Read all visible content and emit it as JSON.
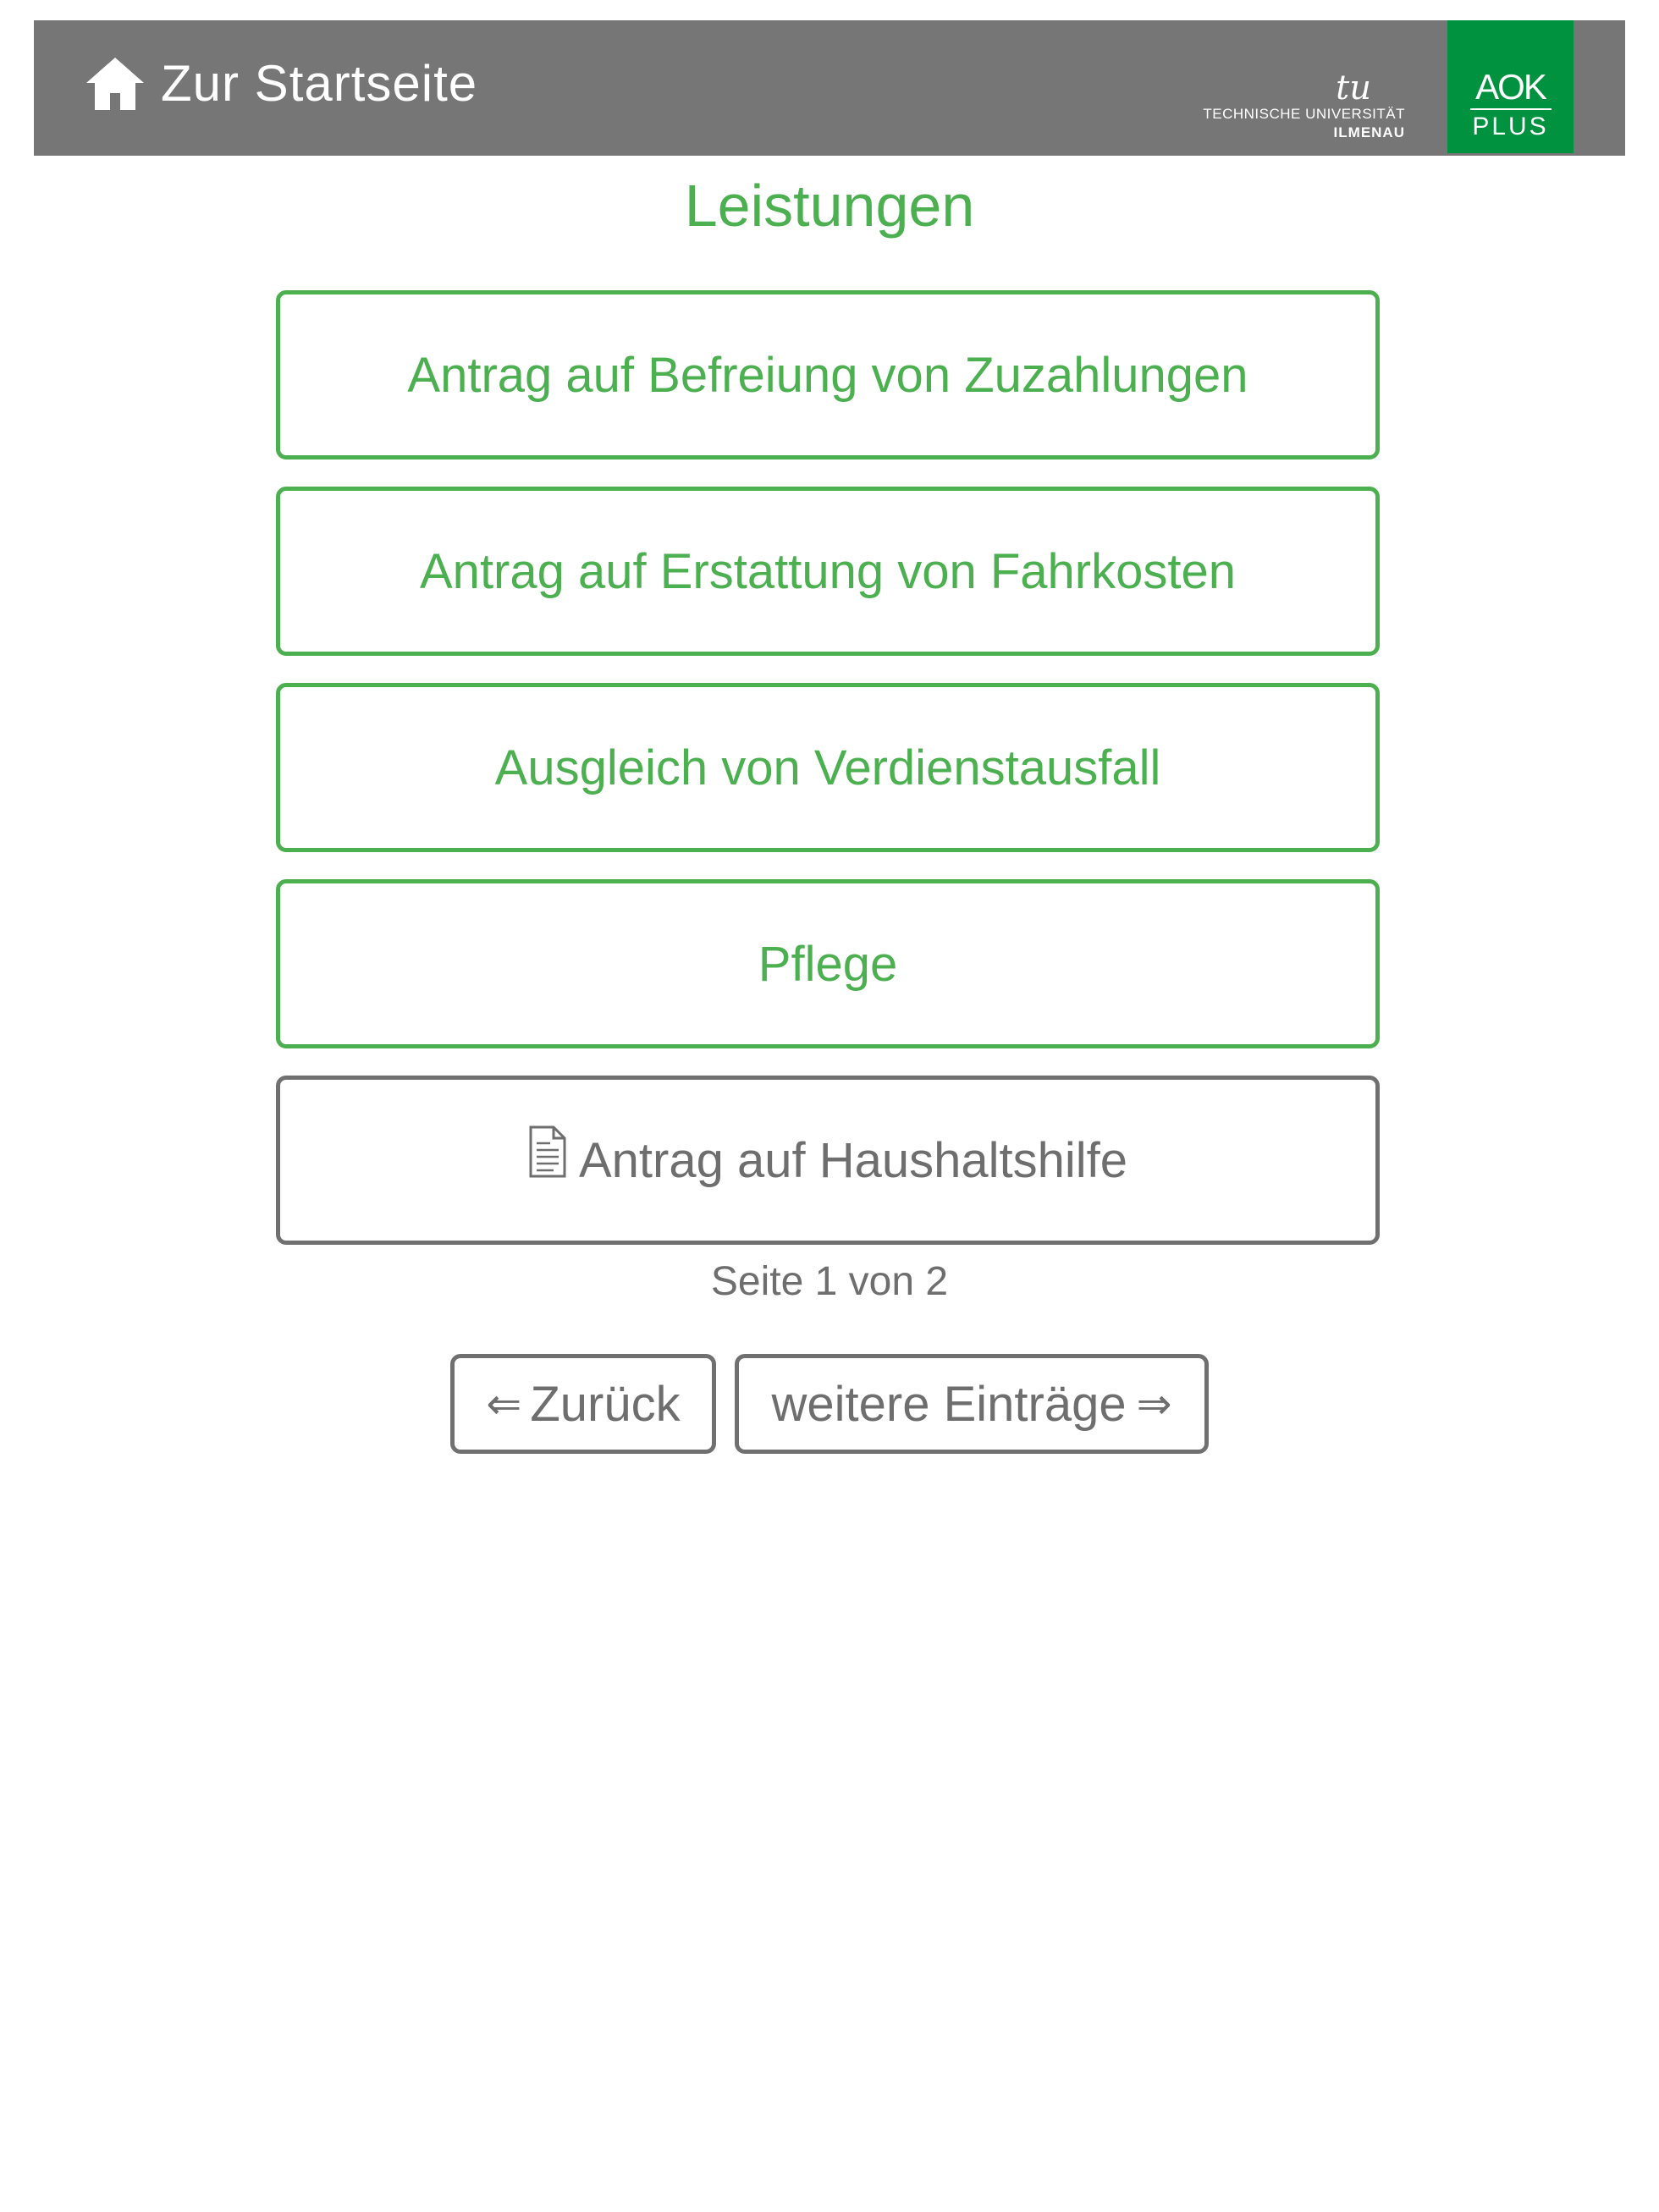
{
  "header": {
    "home_label": "Zur Startseite",
    "home_icon": "home-icon",
    "tu_logo": {
      "mark": "tu",
      "line1": "TECHNISCHE UNIVERSITÄT",
      "line2": "ILMENAU"
    },
    "aok_logo": {
      "top": "AOK",
      "bottom": "PLUS"
    },
    "colors": {
      "header_bg": "#767676",
      "aok_green": "#00923f"
    }
  },
  "page": {
    "title": "Leistungen",
    "accent": "#4caf50",
    "items": [
      {
        "label": "Antrag auf Befreiung von Zuzahlungen"
      },
      {
        "label": "Antrag auf Erstattung von Fahrkosten"
      },
      {
        "label": "Ausgleich von Verdienstausfall"
      },
      {
        "label": "Pflege"
      },
      {
        "label": "Antrag auf Haushaltshilfe",
        "icon": "document-icon"
      }
    ],
    "pagination": {
      "text": "Seite 1 von 2",
      "current": 1,
      "total": 2
    },
    "nav": {
      "back_arrow": "⇐",
      "back_label": "Zurück",
      "next_label": "weitere Einträge",
      "next_arrow": "⇒"
    }
  }
}
